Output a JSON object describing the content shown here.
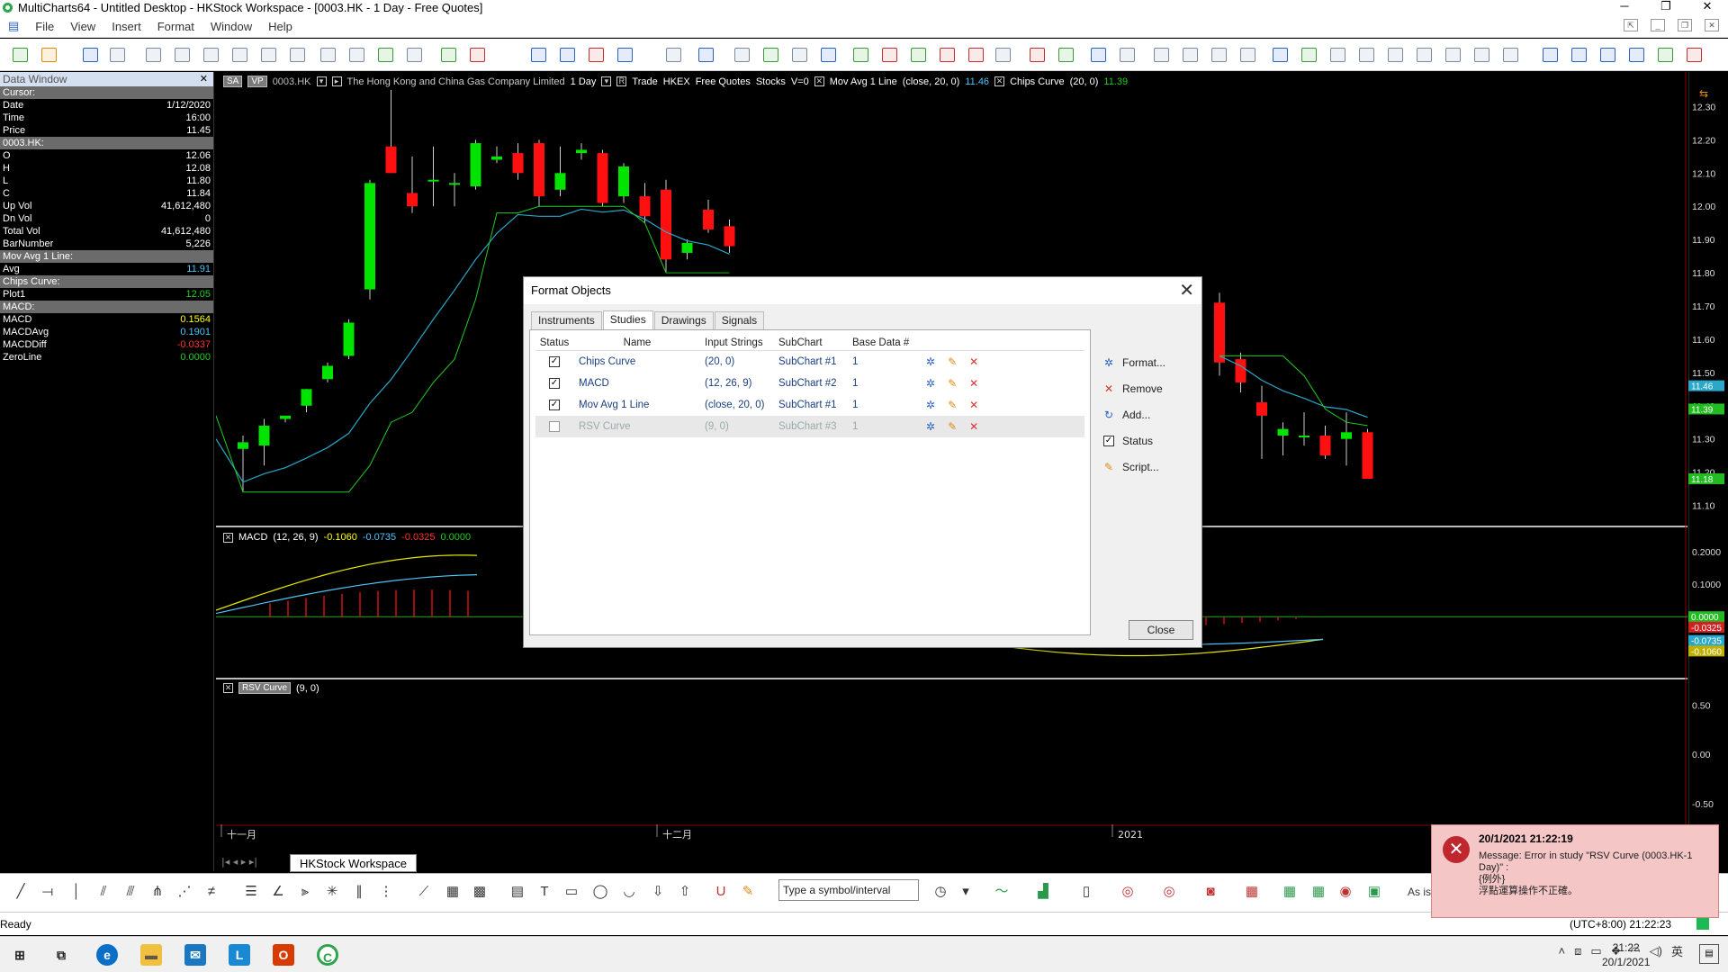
{
  "window": {
    "title": "MultiCharts64 - Untitled Desktop - HKStock Workspace - [0003.HK - 1 Day - Free Quotes]"
  },
  "menu": [
    "File",
    "View",
    "Insert",
    "Format",
    "Window",
    "Help"
  ],
  "data_window": {
    "title": "Data Window",
    "rows": [
      {
        "label": "Cursor:",
        "value": "",
        "section": true
      },
      {
        "label": "Date",
        "value": "1/12/2020"
      },
      {
        "label": "Time",
        "value": "16:00"
      },
      {
        "label": "Price",
        "value": "11.45"
      },
      {
        "label": "0003.HK:",
        "value": "",
        "section": true
      },
      {
        "label": "O",
        "value": "12.06"
      },
      {
        "label": "H",
        "value": "12.08"
      },
      {
        "label": "L",
        "value": "11.80"
      },
      {
        "label": "C",
        "value": "11.84"
      },
      {
        "label": "Up Vol",
        "value": "41,612,480"
      },
      {
        "label": "Dn Vol",
        "value": "0"
      },
      {
        "label": "Total Vol",
        "value": "41,612,480"
      },
      {
        "label": "BarNumber",
        "value": "5,226"
      },
      {
        "label": "Mov Avg 1 Line:",
        "value": "",
        "section": true
      },
      {
        "label": "Avg",
        "value": "11.91",
        "color": "#4fc3f7"
      },
      {
        "label": "Chips Curve:",
        "value": "",
        "section": true
      },
      {
        "label": "Plot1",
        "value": "12.05",
        "color": "#22cc22"
      },
      {
        "label": "MACD:",
        "value": "",
        "section": true
      },
      {
        "label": "MACD",
        "value": "0.1564",
        "color": "#ffff00"
      },
      {
        "label": "MACDAvg",
        "value": "0.1901",
        "color": "#4fc3f7"
      },
      {
        "label": "MACDDiff",
        "value": "-0.0337",
        "color": "#ff3030"
      },
      {
        "label": "ZeroLine",
        "value": "0.0000",
        "color": "#22cc22"
      }
    ]
  },
  "main_legend": {
    "sa": "SA",
    "vp": "VP",
    "symbol": "0003.HK",
    "company": "The Hong Kong and China Gas Company Limited",
    "interval": "1 Day",
    "r": "R",
    "trade": "Trade",
    "exchange": "HKEX",
    "feed": "Free Quotes",
    "type": "Stocks",
    "v": "V=0",
    "ma_name": "Mov Avg 1 Line",
    "ma_inputs": "(close, 20, 0)",
    "ma_value": "11.46",
    "chips_name": "Chips Curve",
    "chips_inputs": "(20, 0)",
    "chips_value": "11.39"
  },
  "macd_legend": {
    "name": "MACD",
    "inputs": "(12, 26, 9)",
    "v1": "-0.1060",
    "v2": "-0.0735",
    "v3": "-0.0325",
    "v4": "0.0000"
  },
  "rsv_legend": {
    "name": "RSV Curve",
    "inputs": "(9, 0)"
  },
  "chart_data": [
    {
      "type": "candlestick",
      "title": "",
      "ylim": [
        11.05,
        12.35
      ],
      "yticks": [
        "12.30",
        "12.20",
        "12.10",
        "12.00",
        "11.90",
        "11.80",
        "11.70",
        "11.60",
        "11.50",
        "11.40",
        "11.30",
        "11.20",
        "11.10"
      ],
      "xlabels": [
        "十一月",
        "十二月",
        "2021"
      ],
      "badges": [
        {
          "value": "11.46",
          "color": "#2aa7c9"
        },
        {
          "value": "11.39",
          "color": "#22bb22"
        },
        {
          "value": "11.18",
          "color": "#22bb22"
        }
      ],
      "candles_left": [
        {
          "o": 11.27,
          "h": 11.31,
          "l": 11.14,
          "c": 11.29
        },
        {
          "o": 11.28,
          "h": 11.36,
          "l": 11.22,
          "c": 11.34
        },
        {
          "o": 11.36,
          "h": 11.37,
          "l": 11.35,
          "c": 11.37
        },
        {
          "o": 11.4,
          "h": 11.45,
          "l": 11.38,
          "c": 11.45
        },
        {
          "o": 11.48,
          "h": 11.53,
          "l": 11.47,
          "c": 11.52
        },
        {
          "o": 11.55,
          "h": 11.66,
          "l": 11.54,
          "c": 11.65
        },
        {
          "o": 11.75,
          "h": 12.08,
          "l": 11.72,
          "c": 12.07
        },
        {
          "o": 12.18,
          "h": 12.35,
          "l": 12.1,
          "c": 12.1
        },
        {
          "o": 12.04,
          "h": 12.15,
          "l": 11.98,
          "c": 12.0
        },
        {
          "o": 12.08,
          "h": 12.18,
          "l": 12.0,
          "c": 12.08
        },
        {
          "o": 12.07,
          "h": 12.1,
          "l": 12.0,
          "c": 12.07
        },
        {
          "o": 12.06,
          "h": 12.2,
          "l": 12.05,
          "c": 12.19
        },
        {
          "o": 12.14,
          "h": 12.18,
          "l": 12.13,
          "c": 12.15
        },
        {
          "o": 12.16,
          "h": 12.19,
          "l": 12.08,
          "c": 12.1
        },
        {
          "o": 12.19,
          "h": 12.2,
          "l": 12.0,
          "c": 12.03
        },
        {
          "o": 12.05,
          "h": 12.18,
          "l": 12.03,
          "c": 12.1
        },
        {
          "o": 12.16,
          "h": 12.19,
          "l": 12.14,
          "c": 12.17
        },
        {
          "o": 12.16,
          "h": 12.17,
          "l": 12.0,
          "c": 12.01
        },
        {
          "o": 12.03,
          "h": 12.13,
          "l": 12.01,
          "c": 12.12
        },
        {
          "o": 12.03,
          "h": 12.07,
          "l": 11.95,
          "c": 11.97
        },
        {
          "o": 12.05,
          "h": 12.08,
          "l": 11.8,
          "c": 11.84
        },
        {
          "o": 11.86,
          "h": 11.9,
          "l": 11.84,
          "c": 11.89
        },
        {
          "o": 11.99,
          "h": 12.02,
          "l": 11.92,
          "c": 11.93
        },
        {
          "o": 11.94,
          "h": 11.96,
          "l": 11.86,
          "c": 11.88
        }
      ],
      "candles_right": [
        {
          "o": 11.71,
          "h": 11.74,
          "l": 11.49,
          "c": 11.53
        },
        {
          "o": 11.54,
          "h": 11.56,
          "l": 11.44,
          "c": 11.47
        },
        {
          "o": 11.41,
          "h": 11.46,
          "l": 11.24,
          "c": 11.37
        },
        {
          "o": 11.31,
          "h": 11.35,
          "l": 11.25,
          "c": 11.33
        },
        {
          "o": 11.31,
          "h": 11.38,
          "l": 11.28,
          "c": 11.31
        },
        {
          "o": 11.31,
          "h": 11.34,
          "l": 11.24,
          "c": 11.25
        },
        {
          "o": 11.3,
          "h": 11.38,
          "l": 11.22,
          "c": 11.32
        },
        {
          "o": 11.32,
          "h": 11.33,
          "l": 11.18,
          "c": 11.18
        }
      ]
    },
    {
      "type": "line",
      "title": "MACD",
      "ylim": [
        -0.18,
        0.27
      ],
      "yticks": [
        "0.2000",
        "0.1000"
      ],
      "badges": [
        {
          "value": "0.0000",
          "color": "#22bb22"
        },
        {
          "value": "-0.0325",
          "color": "#d02020"
        },
        {
          "value": "-0.0735",
          "color": "#2aa7c9"
        },
        {
          "value": "-0.1060",
          "color": "#c0b000"
        }
      ]
    },
    {
      "type": "line",
      "title": "RSV Curve",
      "ylim": [
        -0.7,
        0.75
      ],
      "yticks": [
        "0.50",
        "0.00",
        "-0.50"
      ]
    }
  ],
  "dialog": {
    "title": "Format Objects",
    "tabs": [
      "Instruments",
      "Studies",
      "Drawings",
      "Signals"
    ],
    "active_tab": "Studies",
    "columns": [
      "Status",
      "Name",
      "Input Strings",
      "SubChart",
      "Base Data #"
    ],
    "rows": [
      {
        "checked": true,
        "name": "Chips Curve",
        "inputs": "(20,  0)",
        "subchart": "SubChart #1",
        "base": "1"
      },
      {
        "checked": true,
        "name": "MACD",
        "inputs": "(12,  26,  9)",
        "subchart": "SubChart #2",
        "base": "1"
      },
      {
        "checked": true,
        "name": "Mov Avg 1 Line",
        "inputs": "(close,  20,  0)",
        "subchart": "SubChart #1",
        "base": "1"
      },
      {
        "checked": false,
        "name": "RSV Curve",
        "inputs": "(9,  0)",
        "subchart": "SubChart #3",
        "base": "1"
      }
    ],
    "side_buttons": [
      {
        "label": "Format...",
        "icon": "gear-icon"
      },
      {
        "label": "Remove",
        "icon": "x-icon"
      },
      {
        "label": "Add...",
        "icon": "add-icon"
      },
      {
        "label": "Status",
        "icon": "checkbox-icon"
      },
      {
        "label": "Script...",
        "icon": "pencil-icon"
      }
    ],
    "close_label": "Close"
  },
  "workspace_tab": "HKStock Workspace",
  "symbol_selector": {
    "placeholder": "Type a symbol/interval"
  },
  "as_is": "As is",
  "status": {
    "ready": "Ready",
    "timezone": "(UTC+8:00) 21:22:23"
  },
  "toast": {
    "title": "20/1/2021 21:22:19",
    "message": "Message: Error in study \"RSV Curve (0003.HK-1 Day)\" :",
    "line2": "{例外}",
    "line3": "浮點運算操作不正確。"
  },
  "taskbar": {
    "time": "21:22",
    "date": "20/1/2021",
    "ime": "英"
  }
}
